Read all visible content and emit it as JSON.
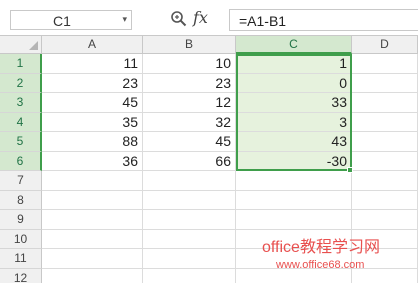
{
  "formula_bar": {
    "name_box": "C1",
    "fx_label": "fx",
    "formula": "=A1-B1"
  },
  "columns": [
    "A",
    "B",
    "C",
    "D"
  ],
  "selected_column": "C",
  "rows": [
    {
      "label": "1",
      "a": "11",
      "b": "10",
      "c": "1"
    },
    {
      "label": "2",
      "a": "23",
      "b": "23",
      "c": "0"
    },
    {
      "label": "3",
      "a": "45",
      "b": "12",
      "c": "33"
    },
    {
      "label": "4",
      "a": "35",
      "b": "32",
      "c": "3"
    },
    {
      "label": "5",
      "a": "88",
      "b": "45",
      "c": "43"
    },
    {
      "label": "6",
      "a": "36",
      "b": "66",
      "c": "-30"
    },
    {
      "label": "7",
      "a": "",
      "b": "",
      "c": ""
    },
    {
      "label": "8",
      "a": "",
      "b": "",
      "c": ""
    },
    {
      "label": "9",
      "a": "",
      "b": "",
      "c": ""
    },
    {
      "label": "10",
      "a": "",
      "b": "",
      "c": ""
    },
    {
      "label": "11",
      "a": "",
      "b": "",
      "c": ""
    },
    {
      "label": "12",
      "a": "",
      "b": "",
      "c": ""
    }
  ],
  "selected_rows": 6,
  "watermark": {
    "title": "office教程学习网",
    "url": "www.office68.com"
  },
  "colors": {
    "selection": "#3f9e4b",
    "selection_fill": "#e6f2dd",
    "watermark": "#e8504f"
  }
}
